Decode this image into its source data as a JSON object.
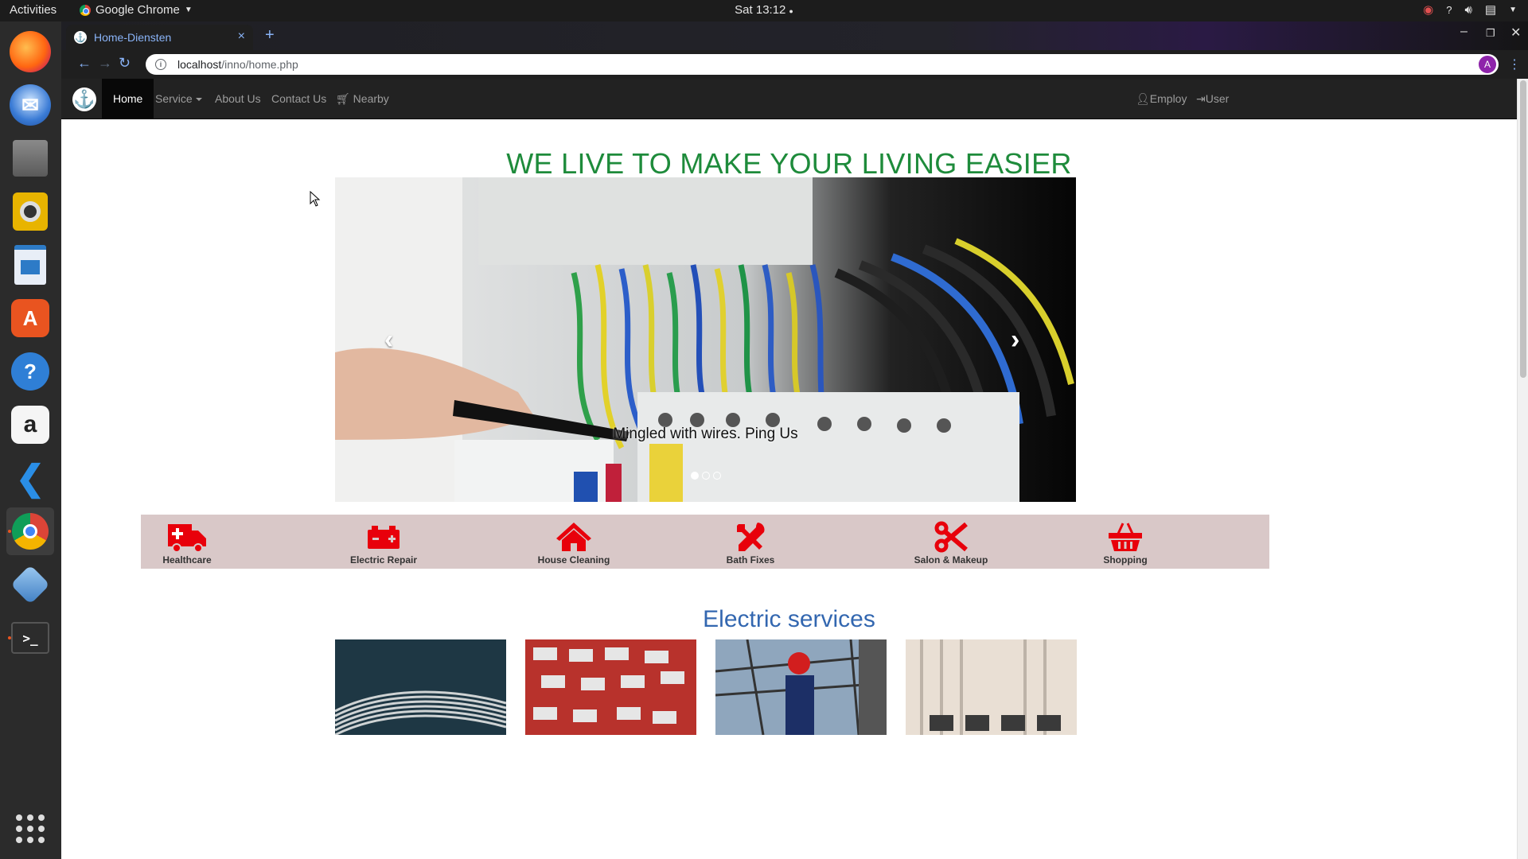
{
  "topbar": {
    "activities": "Activities",
    "app_name": "Google Chrome",
    "clock": "Sat 13:12",
    "icons": [
      "camera-icon",
      "help-icon",
      "volume-icon",
      "clipboard-icon",
      "menu-arrow-icon"
    ]
  },
  "dock": {
    "items": [
      "firefox",
      "thunderbird",
      "files",
      "rhythmbox",
      "libreoffice-impress",
      "ubuntu-software",
      "help",
      "amazon",
      "vscode",
      "chrome",
      "virtualbox",
      "terminal",
      "show-apps"
    ]
  },
  "browser": {
    "tab_title": "Home-Diensten",
    "url_host": "localhost",
    "url_path": "/inno/home.php",
    "avatar_letter": "A"
  },
  "navbar": {
    "links": {
      "home": "Home",
      "service": "Service",
      "about": "About Us",
      "contact": "Contact Us",
      "nearby": "Nearby",
      "employ": "Employ",
      "user": "User"
    }
  },
  "hero": {
    "headline": "WE LIVE TO MAKE YOUR LIVING EASIER",
    "caption": "Mingled with wires. Ping Us",
    "slide_count": 3,
    "active_slide": 1
  },
  "services": [
    {
      "label": "Healthcare",
      "icon": "ambulance-icon"
    },
    {
      "label": "Electric Repair",
      "icon": "battery-icon"
    },
    {
      "label": "House Cleaning",
      "icon": "home-icon"
    },
    {
      "label": "Bath Fixes",
      "icon": "wrench-screwdriver-icon"
    },
    {
      "label": "Salon & Makeup",
      "icon": "scissors-icon"
    },
    {
      "label": "Shopping",
      "icon": "basket-icon"
    }
  ],
  "section": {
    "title": "Electric services"
  },
  "colors": {
    "headline": "#1e8b3b",
    "section_title": "#3367b0",
    "service_icon": "#e8000b",
    "service_bar": "#d9c8c8",
    "navbar": "#222222"
  }
}
